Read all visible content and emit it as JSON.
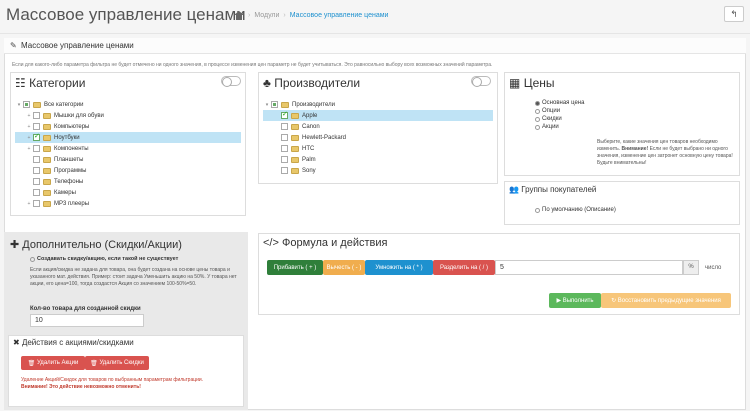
{
  "header": {
    "title": "Массовое управление ценами",
    "breadcrumb": [
      "Модули",
      "Массовое управление ценами"
    ],
    "back_icon": "↰"
  },
  "panel": {
    "title": "Массовое управление ценами",
    "note": "Если для какого-либо параметра фильтра не будет отмечено ни одного значения, в процессе изменения цен параметр не будет учитываться. Это равносильно выбору всех возможных значений параметра."
  },
  "categories": {
    "title": "Категории",
    "items": [
      {
        "label": "Все категории",
        "level": 0,
        "exp": "▾",
        "checked": "semi",
        "selected": false
      },
      {
        "label": "Мышки для обуви",
        "level": 1,
        "exp": "+",
        "checked": "no",
        "selected": false
      },
      {
        "label": "Компьютеры",
        "level": 1,
        "exp": "+",
        "checked": "no",
        "selected": false
      },
      {
        "label": "Ноутбуки",
        "level": 1,
        "exp": "+",
        "checked": "yes",
        "selected": true
      },
      {
        "label": "Компоненты",
        "level": 1,
        "exp": "+",
        "checked": "no",
        "selected": false
      },
      {
        "label": "Планшеты",
        "level": 1,
        "exp": "",
        "checked": "no",
        "selected": false
      },
      {
        "label": "Программы",
        "level": 1,
        "exp": "",
        "checked": "no",
        "selected": false
      },
      {
        "label": "Телефоны",
        "level": 1,
        "exp": "",
        "checked": "no",
        "selected": false
      },
      {
        "label": "Камеры",
        "level": 1,
        "exp": "",
        "checked": "no",
        "selected": false
      },
      {
        "label": "MP3 плееры",
        "level": 1,
        "exp": "+",
        "checked": "no",
        "selected": false
      }
    ]
  },
  "manufacturers": {
    "title": "Производители",
    "items": [
      {
        "label": "Производители",
        "level": 0,
        "exp": "▾",
        "checked": "semi",
        "selected": false
      },
      {
        "label": "Apple",
        "level": 1,
        "exp": "",
        "checked": "yes",
        "selected": true
      },
      {
        "label": "Canon",
        "level": 1,
        "exp": "",
        "checked": "no",
        "selected": false
      },
      {
        "label": "Hewlett-Packard",
        "level": 1,
        "exp": "",
        "checked": "no",
        "selected": false
      },
      {
        "label": "HTC",
        "level": 1,
        "exp": "",
        "checked": "no",
        "selected": false
      },
      {
        "label": "Palm",
        "level": 1,
        "exp": "",
        "checked": "no",
        "selected": false
      },
      {
        "label": "Sony",
        "level": 1,
        "exp": "",
        "checked": "no",
        "selected": false
      }
    ]
  },
  "prices": {
    "title": "Цены",
    "options": [
      {
        "label": "Основная цена",
        "checked": true
      },
      {
        "label": "Опции",
        "checked": false
      },
      {
        "label": "Скидки",
        "checked": false
      },
      {
        "label": "Акции",
        "checked": false
      }
    ],
    "hint_1": "Выберите, какие значения цен товаров необходимо изменить. ",
    "hint_bold": "Внимание!",
    "hint_2": "Если не будет выбрано ни одного значения, изменение цен затронет основную цену товара! Будьте внимательны!"
  },
  "groups": {
    "title": "Группы покупателей",
    "option": "По умолчанию (Описание)"
  },
  "extra": {
    "title": "Дополнительно (Скидки/Акции)",
    "create_label": "Создавать скидку/акцию, если такой не существует",
    "description": "Если акция/скидка не задана для товара, она будет создана на основе цены товара и указанного мат. действия. Пример: стоит задача Уменьшить акцию на 50%. У товара нет акции, его цена=100, тогда создастся Акция со значением 100-50%=50.",
    "qty_label": "Кол-во товара для созданной скидки",
    "qty_value": "10"
  },
  "actions": {
    "title": "Действия с акциями/скидками",
    "delete_special": "Удалить Акции",
    "delete_discount": "Удалить Скидки",
    "warn_1": "Удаление Акций/Скидок для товаров по выбранным параметрам фильтрации.",
    "warn_2": "Внимание! Это действие невозможно отменить!"
  },
  "formula": {
    "title": "Формула и действия",
    "add": "Прибавить ( + )",
    "subtract": "Вычесть ( - )",
    "multiply": "Умножить на ( * )",
    "divide": "Разделить на ( / )",
    "value": "5",
    "percent": "%",
    "number": "число",
    "execute": "Выполнить",
    "restore": "Восстановить предыдущие значения"
  },
  "colors": {
    "accent": "#1e91cf",
    "add": "#2f7f3a",
    "subtract": "#f0ad4e",
    "multiply": "#1e91cf",
    "divide": "#d9534f",
    "execute": "#5cb85c",
    "restore": "#f7c67a"
  }
}
